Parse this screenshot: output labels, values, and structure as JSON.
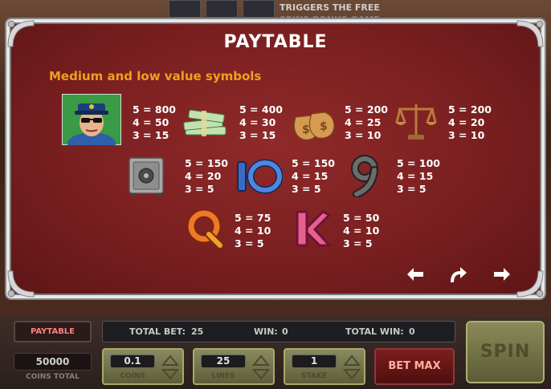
{
  "teaser": {
    "text_line1": "TRIGGERS THE FREE",
    "text_line2": "SPINS BONUS GAME"
  },
  "paytable": {
    "title": "PAYTABLE",
    "subtitle": "Medium and low value symbols",
    "symbols": [
      {
        "name": "police-officer",
        "pays": [
          "5 = 800",
          "4 = 50",
          "3 = 15"
        ]
      },
      {
        "name": "cash-stacks",
        "pays": [
          "5 = 400",
          "4 = 30",
          "3 = 15"
        ]
      },
      {
        "name": "money-bags",
        "pays": [
          "5 = 200",
          "4 = 25",
          "3 = 10"
        ]
      },
      {
        "name": "scales-of-justice",
        "pays": [
          "5 = 200",
          "4 = 20",
          "3 = 10"
        ]
      },
      {
        "name": "safe",
        "pays": [
          "5 = 150",
          "4 = 20",
          "3 = 5"
        ]
      },
      {
        "name": "ten",
        "pays": [
          "5 = 150",
          "4 = 15",
          "3 = 5"
        ]
      },
      {
        "name": "nine",
        "pays": [
          "5 = 100",
          "4 = 15",
          "3 = 5"
        ]
      },
      {
        "name": "queen",
        "pays": [
          "5 = 75",
          "4 = 10",
          "3 = 5"
        ]
      },
      {
        "name": "king",
        "pays": [
          "5 = 50",
          "4 = 10",
          "3 = 5"
        ]
      }
    ]
  },
  "controls": {
    "paytable_label": "PAYTABLE",
    "coins_total_value": "50000",
    "coins_total_label": "COINS TOTAL",
    "total_bet_label": "TOTAL BET:",
    "total_bet_value": "25",
    "win_label": "WIN:",
    "win_value": "0",
    "total_win_label": "TOTAL WIN:",
    "total_win_value": "0",
    "coins_value": "0.1",
    "coins_label": "COINS",
    "lines_value": "25",
    "lines_label": "LINES",
    "stake_value": "1",
    "stake_label": "STAKE",
    "bet_max_label": "BET MAX",
    "spin_label": "SPIN"
  },
  "colors": {
    "panel_red": "#7a1f20",
    "subtitle_orange": "#f0a020",
    "spin_olive": "#8a8a58",
    "bet_max_red": "#7d1d1d"
  }
}
